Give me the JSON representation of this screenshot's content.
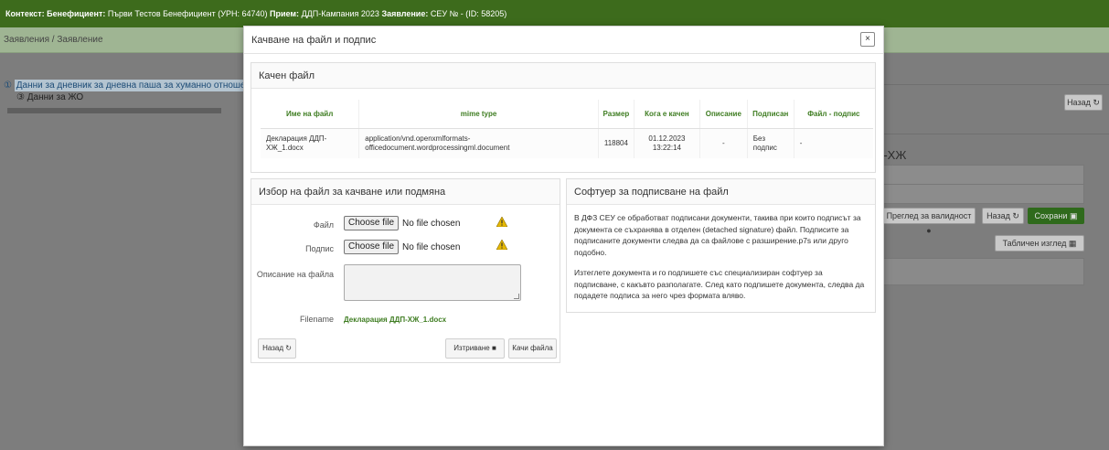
{
  "context_bar": {
    "label_context": "Контекст:",
    "label_beneficiary": "Бенефициент:",
    "beneficiary": "Първи Тестов Бенефициент (УРН: 64740)",
    "label_intake": "Прием:",
    "intake": "ДДП-Кампания 2023",
    "label_application": "Заявление:",
    "application": "СЕУ № - (ID: 58205)"
  },
  "breadcrumb": "Заявления / Заявление",
  "tree": {
    "item1": "Данни за дневник за дневна паша за хуманно отношение",
    "item1_marker": "①",
    "item2": "Данни за ЖО",
    "item2_marker": "③"
  },
  "background": {
    "back_label": "Назад",
    "heading": "П-ХЖ",
    "validity_label": "Преглед за валидност",
    "back2_label": "Назад",
    "save_label": "Сохрани",
    "table_view_label": "Табличен изглед"
  },
  "modal": {
    "title": "Качване на файл и подпис",
    "close": "×",
    "uploaded": {
      "title": "Качен файл",
      "columns": [
        "Име на файл",
        "mime type",
        "Размер",
        "Кога е качен",
        "Описание",
        "Подписан",
        "Файл - подпис"
      ],
      "rows": [
        {
          "name": "Декларация ДДП-ХЖ_1.docx",
          "mime": "application/vnd.openxmlformats-officedocument.wordprocessingml.document",
          "size": "118804",
          "uploaded_at": "01.12.2023 13:22:14",
          "description": "-",
          "signed": "Без подпис",
          "signature_file": "-"
        }
      ]
    },
    "select": {
      "title": "Избор на файл за качване или подмяна",
      "file_label": "Файл",
      "signature_label": "Подпис",
      "choose_button": "Choose file",
      "no_file": "No file chosen",
      "description_label": "Описание на файла",
      "filename_label": "Filename",
      "filename_value": "Декларация ДДП-ХЖ_1.docx",
      "back_button": "Назад",
      "delete_button": "Изтриване",
      "upload_button": "Качи файла"
    },
    "software": {
      "title": "Софтуер за подписване на файл",
      "paragraph1": "В ДФЗ СЕУ се обработват подписани документи, такива при които подписът за документа се съхранява в отделен (detached signature) файл. Подписите за подписаните документи следва да са файлове с разширение.p7s или друго подобно.",
      "paragraph2": "Изтеглете документа и го подпишете със специализиран софтуер за подписване, с какъвто разполагате. След като подпишете документа, следва да подадете подписа за него чрез формата вляво."
    }
  },
  "colors": {
    "brand_green": "#3f7d22",
    "topbar": "#3d6b1c",
    "warning": "#e6b800"
  }
}
